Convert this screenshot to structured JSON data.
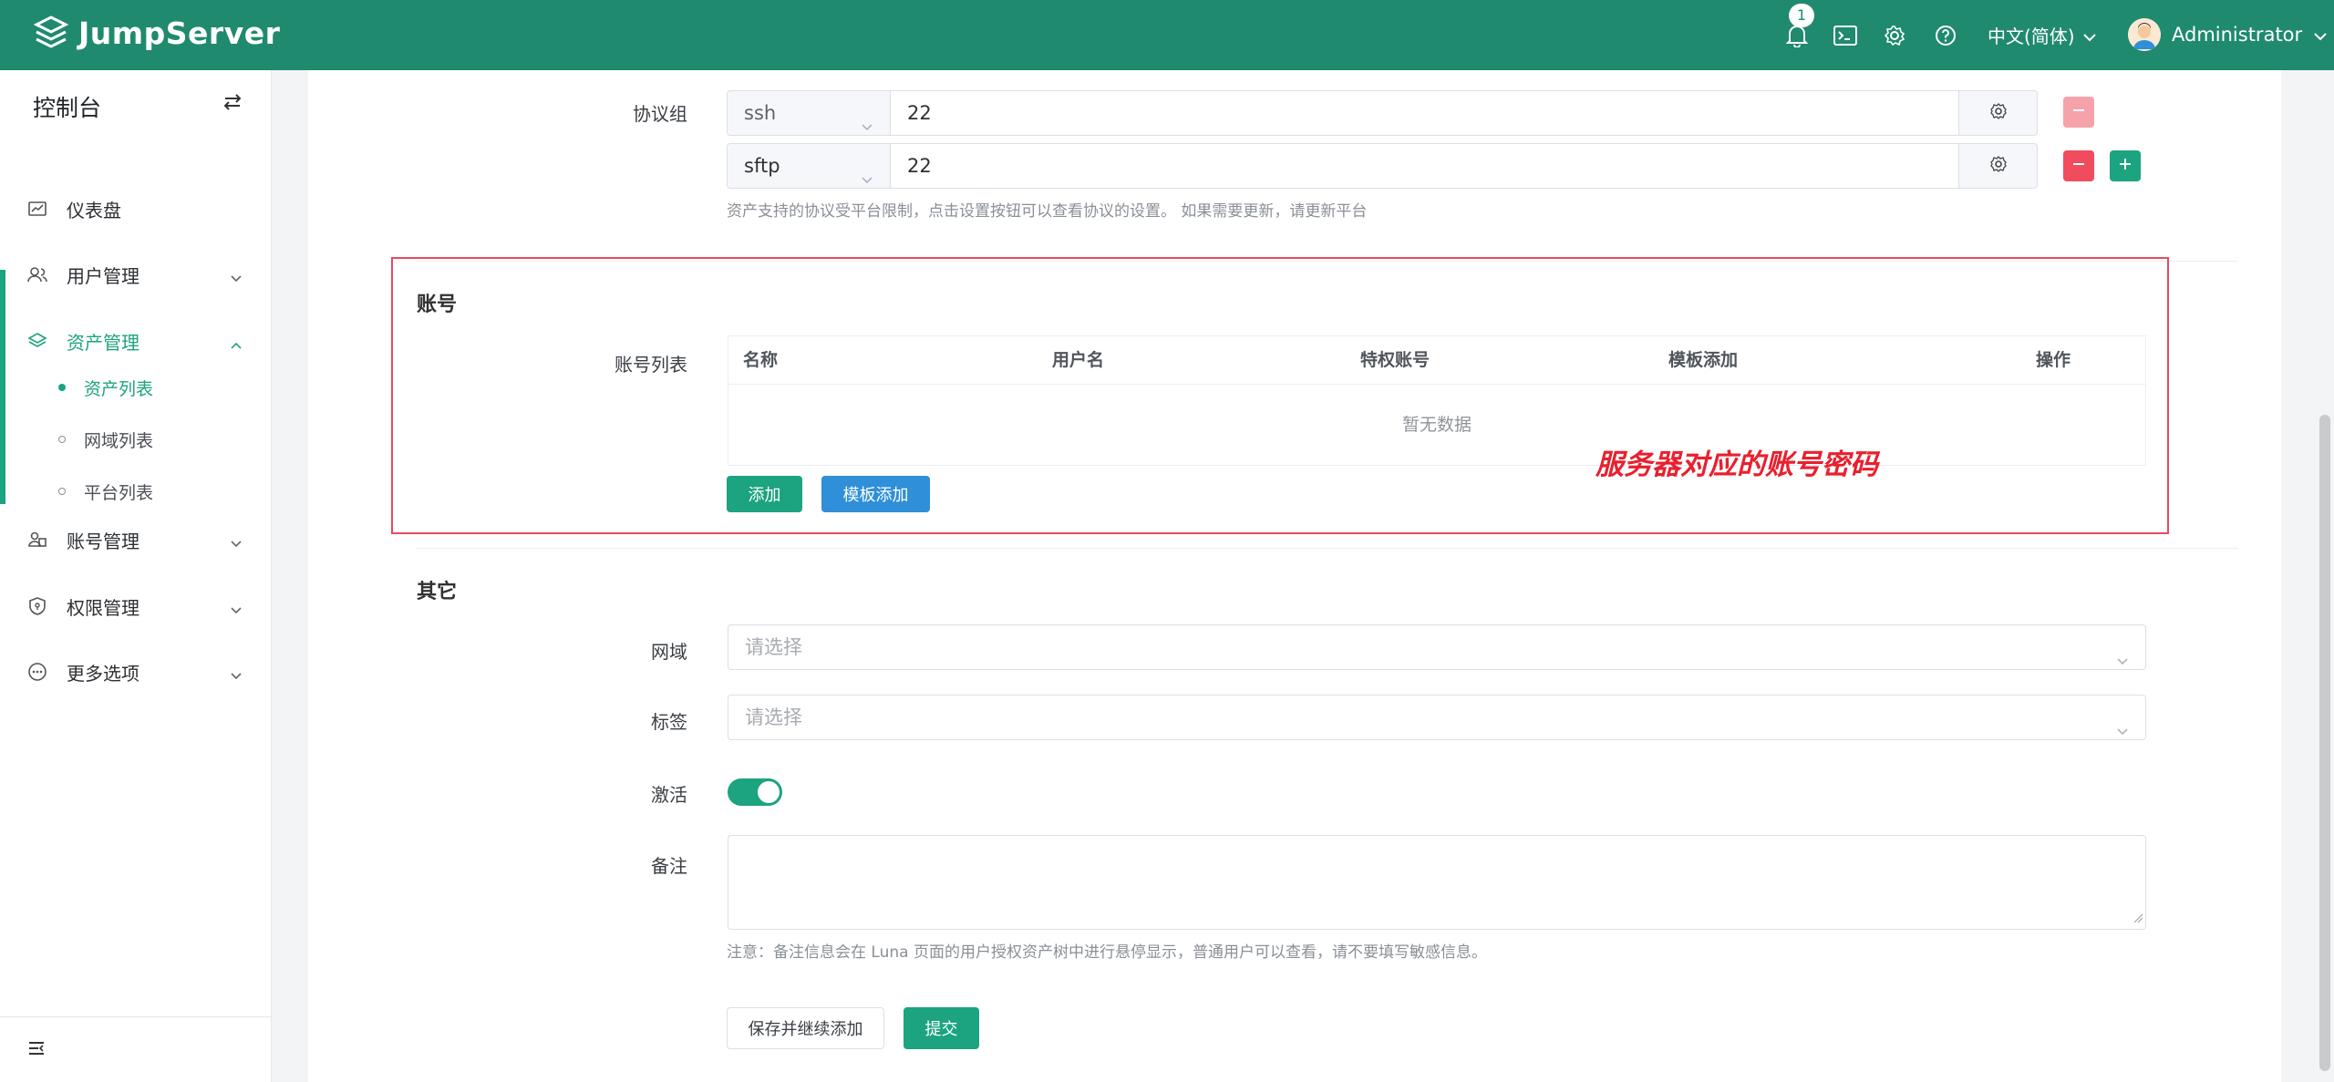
{
  "header": {
    "logo_text": "JumpServer",
    "notification_count": "1",
    "language": "中文(简体)",
    "username": "Administrator"
  },
  "sidebar": {
    "title": "控制台",
    "items": [
      {
        "label": "仪表盘",
        "icon": "dashboard-icon"
      },
      {
        "label": "用户管理",
        "icon": "users-icon"
      },
      {
        "label": "资产管理",
        "icon": "layers-icon"
      },
      {
        "label": "账号管理",
        "icon": "account-icon"
      },
      {
        "label": "权限管理",
        "icon": "shield-icon"
      },
      {
        "label": "更多选项",
        "icon": "more-icon"
      }
    ],
    "sub_items": [
      {
        "label": "资产列表",
        "selected": true
      },
      {
        "label": "网域列表",
        "selected": false
      },
      {
        "label": "平台列表",
        "selected": false
      }
    ]
  },
  "form": {
    "protocol_label": "协议组",
    "protocols": [
      {
        "name": "ssh",
        "port": "22"
      },
      {
        "name": "sftp",
        "port": "22"
      }
    ],
    "protocol_hint": "资产支持的协议受平台限制，点击设置按钮可以查看协议的设置。 如果需要更新，请更新平台",
    "account_section": "账号",
    "account_list_label": "账号列表",
    "table_columns": [
      "名称",
      "用户名",
      "特权账号",
      "模板添加",
      "操作"
    ],
    "table_empty": "暂无数据",
    "add_button": "添加",
    "template_add_button": "模板添加",
    "annotation": "服务器对应的账号密码",
    "other_section": "其它",
    "domain_label": "网域",
    "domain_placeholder": "请选择",
    "tags_label": "标签",
    "tags_placeholder": "请选择",
    "active_label": "激活",
    "active": true,
    "comment_label": "备注",
    "comment_hint": "注意：备注信息会在 Luna 页面的用户授权资产树中进行悬停显示，普通用户可以查看，请不要填写敏感信息。",
    "save_continue_button": "保存并继续添加",
    "submit_button": "提交"
  },
  "colors": {
    "brand": "#1f8a6e",
    "accent": "#1ca37f",
    "danger": "#f14c5d",
    "primary_blue": "#2f8fd8",
    "annotation": "#e8202e"
  }
}
